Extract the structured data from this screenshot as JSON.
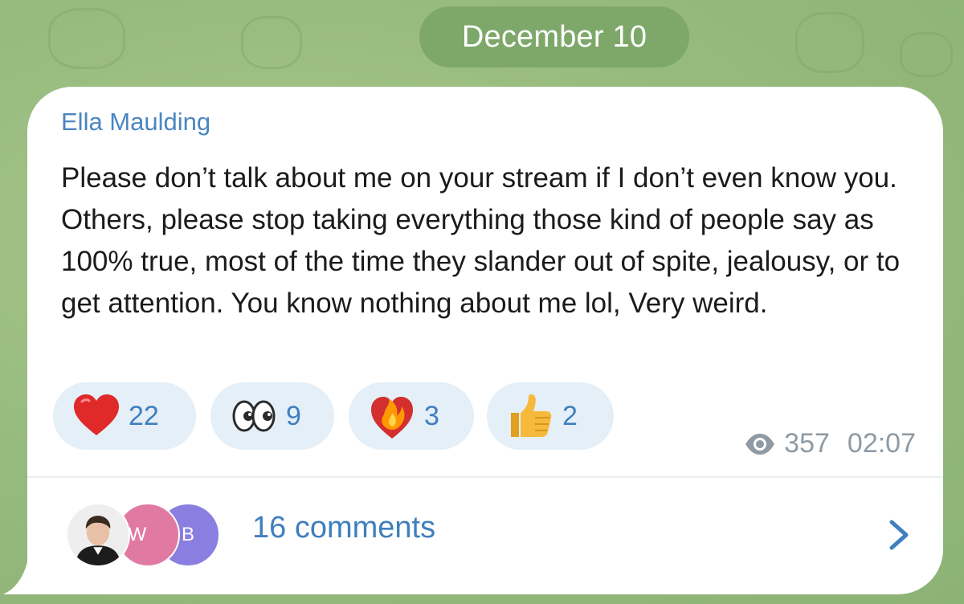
{
  "date_separator": "December 10",
  "message": {
    "sender": "Ella Maulding",
    "text": "Please don’t talk about me on your stream if I don’t even know you. Others, please stop taking everything those kind of people say as 100% true, most of the time they slander out of spite, jealousy, or to get attention. You know nothing about me lol, Very weird.",
    "reactions": [
      {
        "icon": "red-heart-icon",
        "count": "22"
      },
      {
        "icon": "eyes-icon",
        "count": "9"
      },
      {
        "icon": "heart-on-fire-icon",
        "count": "3"
      },
      {
        "icon": "thumbs-up-icon",
        "count": "2"
      }
    ],
    "views": "357",
    "time": "02:07",
    "views_icon": "eye-icon"
  },
  "comments": {
    "avatars": [
      {
        "type": "photo",
        "icon": "user-photo-avatar"
      },
      {
        "type": "initial",
        "initial": "W",
        "color": "#e07aa3"
      },
      {
        "type": "initial",
        "initial": "B",
        "color": "#8a7ee0"
      }
    ],
    "label": "16 comments",
    "chevron_icon": "chevron-right-icon"
  },
  "colors": {
    "background": "#98bb7f",
    "date_pill": "#7ea86a",
    "accent_blue": "#3f7fbd",
    "sender_name": "#4a86c0",
    "reaction_bg": "#e5eff7"
  }
}
